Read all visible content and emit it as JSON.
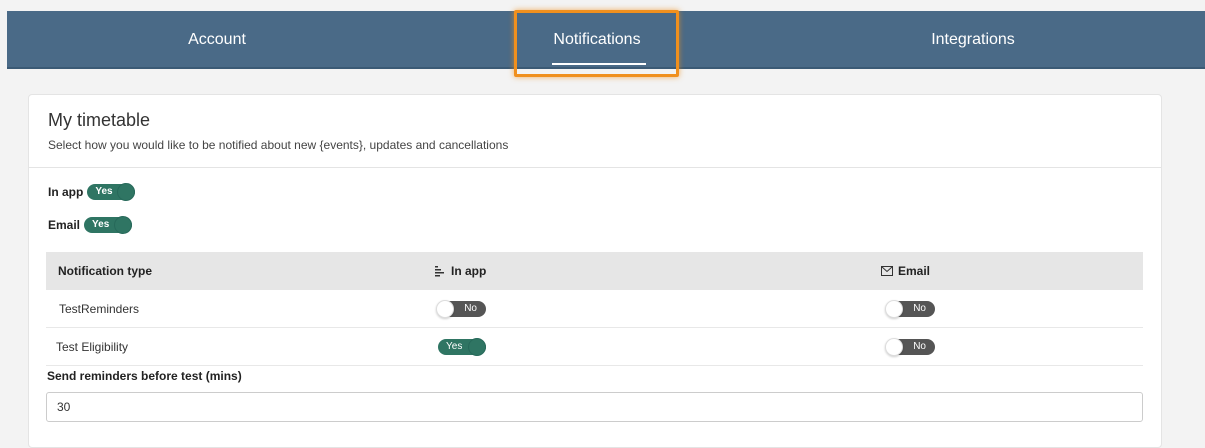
{
  "nav": {
    "tabs": [
      {
        "label": "Account"
      },
      {
        "label": "Notifications",
        "active": true
      },
      {
        "label": "Integrations"
      }
    ]
  },
  "card": {
    "title": "My timetable",
    "subtitle": "Select how you would like to be notified about new {events}, updates and cancellations"
  },
  "channels": {
    "in_app": {
      "label": "In app",
      "state": "Yes"
    },
    "email": {
      "label": "Email",
      "state": "Yes"
    }
  },
  "table": {
    "headers": [
      "Notification type",
      "In app",
      "Email"
    ],
    "header_icons": [
      "list-icon",
      "envelope-icon"
    ],
    "rows": [
      {
        "type": "TestReminders",
        "in_app": "No",
        "email": "No"
      },
      {
        "type": "Test Eligibility",
        "in_app": "Yes",
        "email": "No"
      }
    ]
  },
  "reminder": {
    "label": "Send reminders before test (mins)",
    "value": "30"
  },
  "colors": {
    "navbar": "#4a6a87",
    "toggle_on": "#2f7563",
    "toggle_off": "#555555",
    "highlight": "#f0901e"
  }
}
